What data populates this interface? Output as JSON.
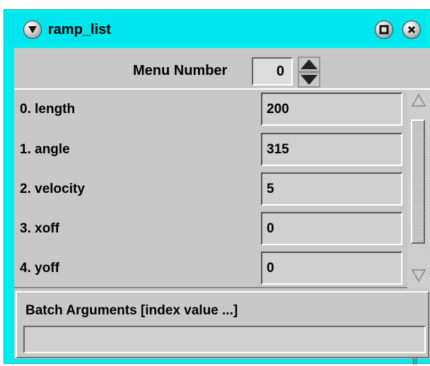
{
  "window": {
    "title": "ramp_list"
  },
  "menu": {
    "label": "Menu Number",
    "value": "0"
  },
  "rows": [
    {
      "label": "0. length",
      "value": "200"
    },
    {
      "label": "1. angle",
      "value": "315"
    },
    {
      "label": "2. velocity",
      "value": "5"
    },
    {
      "label": "3. xoff",
      "value": "0"
    },
    {
      "label": "4. yoff",
      "value": "0"
    }
  ],
  "batch": {
    "label": "Batch Arguments [index value ...]",
    "value": ""
  },
  "icons": {
    "menu": "window-menu-icon",
    "maximize": "maximize-icon",
    "close": "close-icon"
  },
  "colors": {
    "titlebar": "#00e5ee",
    "panel": "#c8c8c8"
  }
}
